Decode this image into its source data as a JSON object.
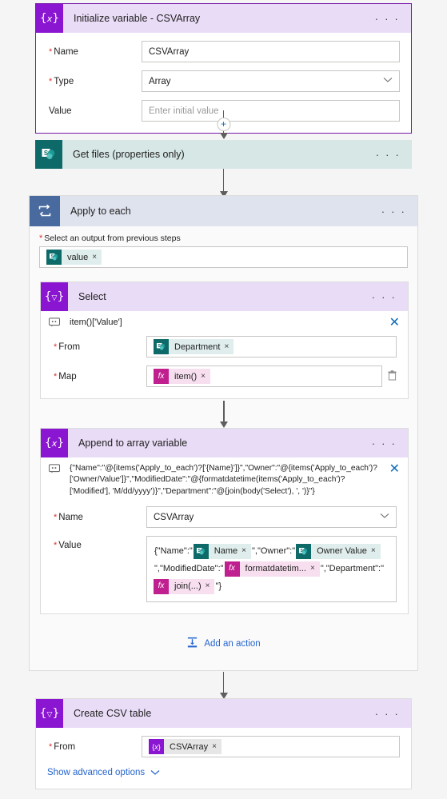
{
  "flow": {
    "init_variable": {
      "title": "Initialize variable - CSVArray",
      "icon": "variable-icon",
      "menu": "· · ·",
      "fields": [
        {
          "label": "Name",
          "required": true,
          "value": "CSVArray",
          "type": "text"
        },
        {
          "label": "Type",
          "required": true,
          "value": "Array",
          "type": "dropdown"
        },
        {
          "label": "Value",
          "required": false,
          "value": "",
          "placeholder": "Enter initial value",
          "type": "text"
        }
      ]
    },
    "add_node_plus": "+",
    "get_files": {
      "title": "Get files (properties only)",
      "icon": "sharepoint-icon",
      "menu": "· · ·"
    },
    "apply_to_each": {
      "title": "Apply to each",
      "icon": "loop-icon",
      "menu": "· · ·",
      "output_label": "Select an output from previous steps",
      "output_chip": {
        "icon": "sharepoint-icon",
        "text": "value",
        "remove": "×"
      },
      "add_action_label": "Add an action"
    },
    "select_action": {
      "title": "Select",
      "icon": "data-operation-icon",
      "menu": "· · ·",
      "comment": "item()['Value']",
      "close": "✕",
      "from_label": "From",
      "from_chip": {
        "icon": "sharepoint-icon",
        "text": "Department",
        "remove": "×"
      },
      "map_label": "Map",
      "map_chip": {
        "icon": "expression-icon",
        "text": "item()",
        "remove": "×"
      },
      "delete_row": "trash-icon"
    },
    "append_action": {
      "title": "Append to array variable",
      "icon": "variable-icon",
      "menu": "· · ·",
      "close": "✕",
      "expression": "{\"Name\":\"@{items('Apply_to_each')?['{Name}']}\",\"Owner\":\"@{items('Apply_to_each')?['Owner/Value']}\",\"ModifiedDate\":\"@{formatdatetime(items('Apply_to_each')?['Modified'], 'M/dd/yyyy')}\",\"Department\":\"@{join(body('Select'), ', ')}\"}",
      "name_label": "Name",
      "name_value": "CSVArray",
      "value_label": "Value",
      "value_parts": [
        {
          "kind": "literal",
          "text": "{\"Name\":\""
        },
        {
          "kind": "chip",
          "icon": "sharepoint-icon",
          "style": "sp",
          "text": "Name",
          "remove": "×"
        },
        {
          "kind": "literal",
          "text": "\",\"Owner\":\""
        },
        {
          "kind": "chip",
          "icon": "sharepoint-icon",
          "style": "sp",
          "text": "Owner Value",
          "remove": "×"
        },
        {
          "kind": "literal",
          "text": "\",\"ModifiedDate\":\""
        },
        {
          "kind": "chip",
          "icon": "expression-icon",
          "style": "fx",
          "text": "formatdatetim...",
          "remove": "×"
        },
        {
          "kind": "literal",
          "text": "\",\"Department\":\""
        },
        {
          "kind": "chip",
          "icon": "expression-icon",
          "style": "fx",
          "text": "join(...)",
          "remove": "×"
        },
        {
          "kind": "literal",
          "text": "\"}"
        }
      ]
    },
    "create_csv": {
      "title": "Create CSV table",
      "icon": "data-operation-icon",
      "menu": "· · ·",
      "from_label": "From",
      "from_chip": {
        "icon": "variable-icon",
        "text": "CSVArray",
        "remove": "×"
      },
      "advanced_label": "Show advanced options",
      "advanced_chevron": "⌄"
    }
  },
  "colors": {
    "purple": "#8a16d1",
    "purple_header": "#e9dcf7",
    "sharepoint_teal": "#0d6a69",
    "loop_blue": "#486a9e",
    "loop_header": "#dfe3ee",
    "link_blue": "#2564cf",
    "required_red": "#e02f2f",
    "expression_magenta": "#bf1f8f"
  }
}
